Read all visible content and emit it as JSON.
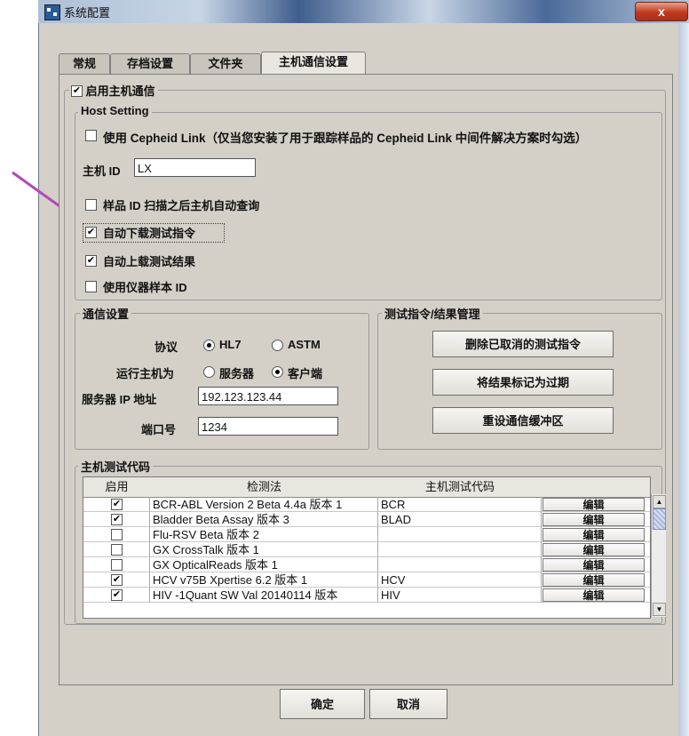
{
  "window": {
    "title": "系统配置",
    "close_glyph": "x"
  },
  "tabs": [
    "常规",
    "存档设置",
    "文件夹",
    "主机通信设置"
  ],
  "enable_host": {
    "label": "启用主机通信",
    "checked": true
  },
  "host_setting": {
    "title": "Host Setting",
    "use_cepheid_label": "使用 Cepheid Link（仅当您安装了用于跟踪样品的 Cepheid Link 中间件解决方案时勾选）",
    "host_id_label": "主机 ID",
    "host_id_value": "LX",
    "options": [
      {
        "label": "样品 ID 扫描之后主机自动查询",
        "checked": false
      },
      {
        "label": "自动下载测试指令",
        "checked": true
      },
      {
        "label": "自动上载测试结果",
        "checked": true
      },
      {
        "label": "使用仪器样本 ID",
        "checked": false
      }
    ]
  },
  "comm": {
    "title": "通信设置",
    "protocol_label": "协议",
    "protocol_options": [
      "HL7",
      "ASTM"
    ],
    "run_as_label": "运行主机为",
    "run_as_options": [
      "服务器",
      "客户端"
    ],
    "ip_label": "服务器 IP 地址",
    "ip_value": "192.123.123.44",
    "port_label": "端口号",
    "port_value": "1234"
  },
  "mgmt": {
    "title": "测试指令/结果管理",
    "buttons": [
      "删除已取消的测试指令",
      "将结果标记为过期",
      "重设通信缓冲区"
    ]
  },
  "codes": {
    "title": "主机测试代码",
    "headers": [
      "启用",
      "检测法",
      "主机测试代码",
      ""
    ],
    "edit_label": "编辑",
    "rows": [
      {
        "enabled": "✔",
        "assay": "BCR-ABL Version 2 Beta 4.4a 版本 1",
        "code": "BCR"
      },
      {
        "enabled": "✔",
        "assay": "Bladder Beta Assay 版本 3",
        "code": "BLAD"
      },
      {
        "enabled": "",
        "assay": "Flu-RSV Beta 版本 2",
        "code": ""
      },
      {
        "enabled": "",
        "assay": "GX CrossTalk 版本 1",
        "code": ""
      },
      {
        "enabled": "",
        "assay": "GX OpticalReads 版本 1",
        "code": ""
      },
      {
        "enabled": "✔",
        "assay": "HCV v75B Xpertise 6.2 版本 1",
        "code": "HCV"
      },
      {
        "enabled": "✔",
        "assay": "HIV -1Quant SW Val 20140114 版本",
        "code": "HIV"
      }
    ]
  },
  "footer": {
    "ok": "确定",
    "cancel": "取消"
  },
  "colors": {
    "arrow": "#b04ab6",
    "window_bg": "#d4d0c8"
  }
}
